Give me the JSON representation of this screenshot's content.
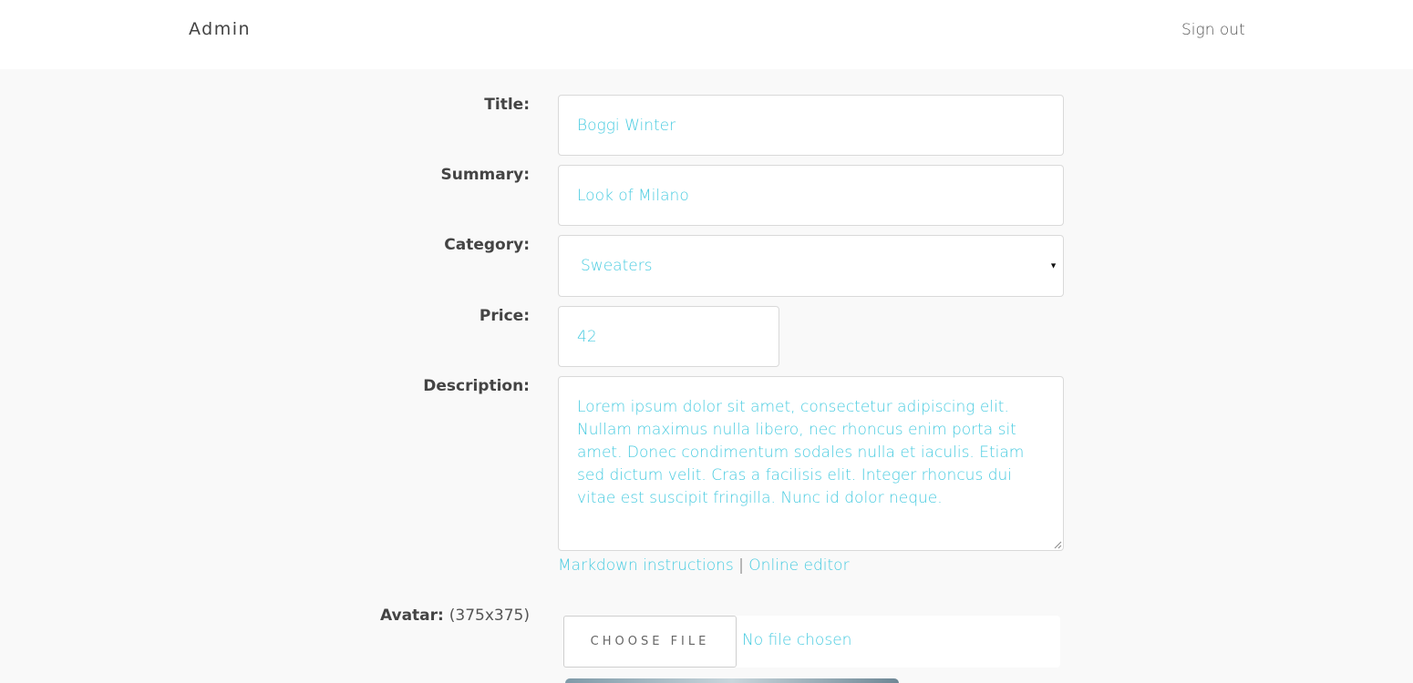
{
  "header": {
    "brand": "Admin",
    "signout_label": "Sign out"
  },
  "form": {
    "title": {
      "label": "Title:",
      "value": "Boggi Winter"
    },
    "summary": {
      "label": "Summary:",
      "value": "Look of Milano"
    },
    "category": {
      "label": "Category:",
      "value": "Sweaters",
      "caret": "▼"
    },
    "price": {
      "label": "Price:",
      "value": "42"
    },
    "description": {
      "label": "Description:",
      "value": "Lorem ipsum dolor sit amet, consectetur adipiscing elit. Nullam maximus nulla libero, nec rhoncus enim porta sit amet. Donec condimentum sodales nulla et iaculis. Etiam sed dictum velit. Cras a facilisis elit. Integer rhoncus dui vitae est suscipit fringilla. Nunc id dolor neque."
    },
    "links": {
      "markdown": "Markdown instructions",
      "separator": "|",
      "editor": "Online editor"
    },
    "avatar": {
      "label": "Avatar:",
      "hint": "(375x375)",
      "button": "CHOOSE FILE",
      "status": "No file chosen"
    }
  },
  "colors": {
    "accent": "#48cbe0",
    "background": "#f9f9f9",
    "header_bg": "#ffffff"
  }
}
